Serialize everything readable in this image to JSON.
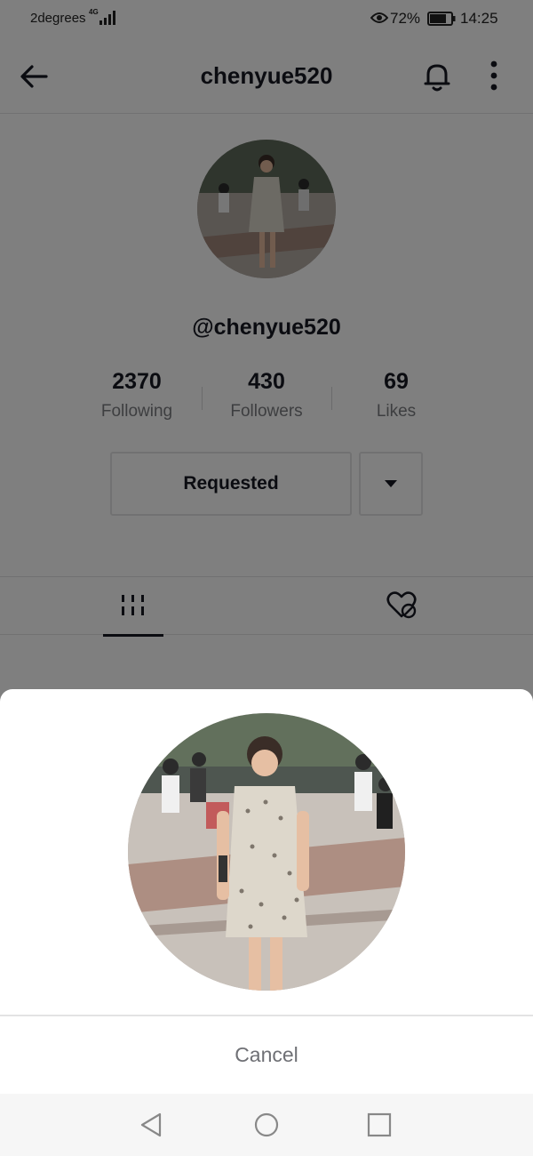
{
  "status_bar": {
    "carrier": "2degrees",
    "network": "4G",
    "battery_percent": "72%",
    "time": "14:25",
    "icons": [
      "signal-icon",
      "eye-icon",
      "battery-icon"
    ]
  },
  "header": {
    "title": "chenyue520",
    "icons": [
      "back-arrow-icon",
      "bell-icon",
      "more-vertical-icon"
    ]
  },
  "profile": {
    "handle": "@chenyue520",
    "stats": [
      {
        "value": "2370",
        "label": "Following"
      },
      {
        "value": "430",
        "label": "Followers"
      },
      {
        "value": "69",
        "label": "Likes"
      }
    ],
    "follow_button_label": "Requested",
    "dropdown_icon": "caret-down-icon"
  },
  "tabs": [
    {
      "name": "videos",
      "icon": "grid-bars-icon",
      "active": true
    },
    {
      "name": "liked",
      "icon": "heart-hidden-icon",
      "active": false
    }
  ],
  "sheet": {
    "cancel_label": "Cancel"
  },
  "colors": {
    "text_primary": "#161823",
    "text_secondary": "#7b7c80",
    "border": "#e3e3e4",
    "overlay": "rgba(0,0,0,0.5)"
  }
}
